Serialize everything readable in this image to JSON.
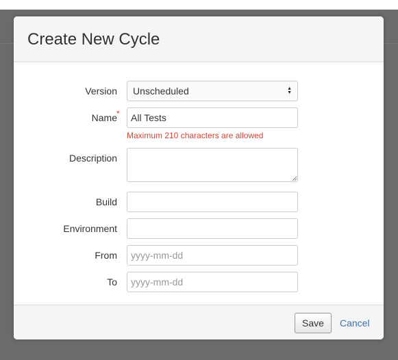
{
  "dialog": {
    "title": "Create New Cycle"
  },
  "form": {
    "version": {
      "label": "Version",
      "selected": "Unscheduled"
    },
    "name": {
      "label": "Name",
      "required_marker": "*",
      "value": "All Tests",
      "error": "Maximum 210 characters are allowed"
    },
    "description": {
      "label": "Description",
      "value": ""
    },
    "build": {
      "label": "Build",
      "value": ""
    },
    "environment": {
      "label": "Environment",
      "value": ""
    },
    "from": {
      "label": "From",
      "placeholder": "yyyy-mm-dd"
    },
    "to": {
      "label": "To",
      "placeholder": "yyyy-mm-dd"
    }
  },
  "footer": {
    "save_label": "Save",
    "cancel_label": "Cancel"
  },
  "colors": {
    "error": "#d04437",
    "link": "#3b73af",
    "header_bg": "#f5f5f5",
    "overlay": "#6b6b6b"
  }
}
